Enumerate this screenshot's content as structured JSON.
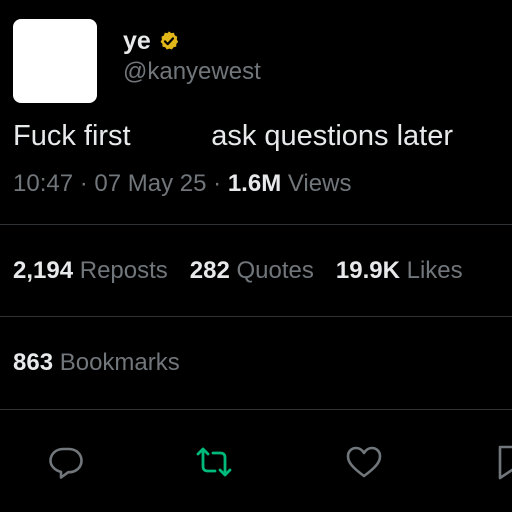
{
  "author": {
    "display_name": "ye",
    "handle": "@kanyewest",
    "verified": true
  },
  "tweet": {
    "text_part1": "Fuck first",
    "text_part2": "ask questions later",
    "time": "10:47",
    "date": "07 May 25",
    "views_count": "1.6M",
    "views_label": "Views"
  },
  "stats": {
    "reposts_count": "2,194",
    "reposts_label": "Reposts",
    "quotes_count": "282",
    "quotes_label": "Quotes",
    "likes_count": "19.9K",
    "likes_label": "Likes",
    "bookmarks_count": "863",
    "bookmarks_label": "Bookmarks"
  },
  "actions": {
    "reply_icon": "reply-icon",
    "repost_icon": "repost-icon",
    "like_icon": "heart-icon",
    "bookmark_icon": "bookmark-icon"
  },
  "colors": {
    "background": "#000000",
    "text": "#e7e9ea",
    "muted": "#71767b",
    "verified_gold": "#e2b719",
    "repost_green": "#00ba7c",
    "divider": "#2f3336"
  }
}
